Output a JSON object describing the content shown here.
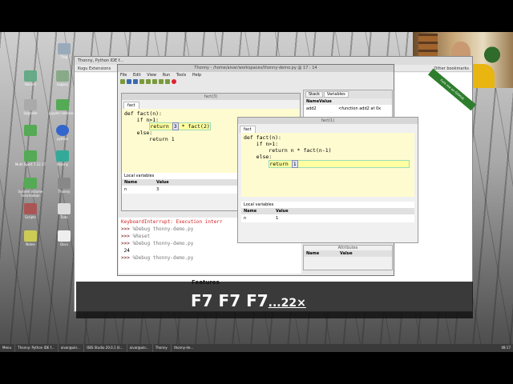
{
  "desktop": {
    "icons": [
      {
        "label": "Tmp",
        "color": "#9ab"
      },
      {
        "label": "Recent",
        "color": "#6a8"
      },
      {
        "label": "Legacy",
        "color": "#8a8"
      },
      {
        "label": "Upgrade",
        "color": "#aaa"
      },
      {
        "label": "Jupyter notebook",
        "color": "#5a5"
      },
      {
        "label": "python",
        "color": "#36c"
      },
      {
        "label": "thonny",
        "color": "#3a9"
      },
      {
        "label": "Multi Sport 7.22.17",
        "color": "#5a5"
      },
      {
        "label": "System Volume Information",
        "color": "#5a5"
      },
      {
        "label": "Thonny",
        "color": "#888"
      },
      {
        "label": "Scripts",
        "color": "#a55"
      },
      {
        "label": "Todo",
        "color": "#ddd"
      },
      {
        "label": "Notes",
        "color": "#cc5"
      },
      {
        "label": "Docs",
        "color": "#eee"
      }
    ]
  },
  "browser": {
    "tab_title": "Thonny, Python IDE f...",
    "bookmarks": "Kogu   Extensions",
    "other_bookmarks": "Other bookmarks",
    "ribbon": "Fork me on GitHub",
    "page_heading": "Features"
  },
  "thonny": {
    "title": "Thonny - /home/aivar/workspaces/thonny-demo.py @ 17 : 14",
    "menu": [
      "File",
      "Edit",
      "View",
      "Run",
      "Tools",
      "Help"
    ],
    "frame1": {
      "title": "fact(3)",
      "tab": "fact",
      "code": {
        "line1_kw": "def",
        "line1_rest": " fact(n):",
        "line2": "    if n>1:",
        "return": "return",
        "value": "3",
        "rest": "* fact(2)",
        "else": "    else:",
        "ret1": "        return 1"
      },
      "vars_title": "Local variables",
      "vars_header": [
        "Name",
        "Value"
      ],
      "vars": [
        {
          "name": "n",
          "value": "3"
        }
      ]
    },
    "frame2": {
      "title": "fact(1)",
      "tab": "fact",
      "code": {
        "line1_kw": "def",
        "line1_rest": " fact(n):",
        "line2": "    if n>1:",
        "line3": "        return n * fact(n-1)",
        "else": "    else:",
        "return": "return",
        "value": "1"
      },
      "vars_title": "Local variables",
      "vars_header": [
        "Name",
        "Value"
      ],
      "vars": [
        {
          "name": "n",
          "value": "1"
        }
      ]
    },
    "right_panel": {
      "tabs": [
        "Stack",
        "Variables"
      ],
      "header": [
        "Name",
        "Value"
      ],
      "rows": [
        {
          "name": "add2",
          "value": "<function add2 at 0x"
        }
      ]
    },
    "attributes": {
      "title": "Attributes",
      "header": [
        "Name",
        "Value"
      ]
    },
    "shell": {
      "error_line": "KeyboardInterrupt: Execution interr",
      "prompt": ">>>",
      "lines": [
        "%Debug thonny-demo.py",
        "%Reset",
        "%Debug thonny-demo.py"
      ],
      "output": "24",
      "last_line": "%Debug thonny-demo.py"
    }
  },
  "overlay": {
    "keys": "F7 F7 F7",
    "count": "...22×"
  },
  "taskbar": {
    "menu": "Menu",
    "tasks": [
      "Thonny: Python IDE f...",
      "aivar@ukr...",
      "OBS Studio 20.0.1 (li...",
      "aivar@ukr...",
      "Thonny",
      "thonny-de..."
    ],
    "clock": "08:17"
  }
}
